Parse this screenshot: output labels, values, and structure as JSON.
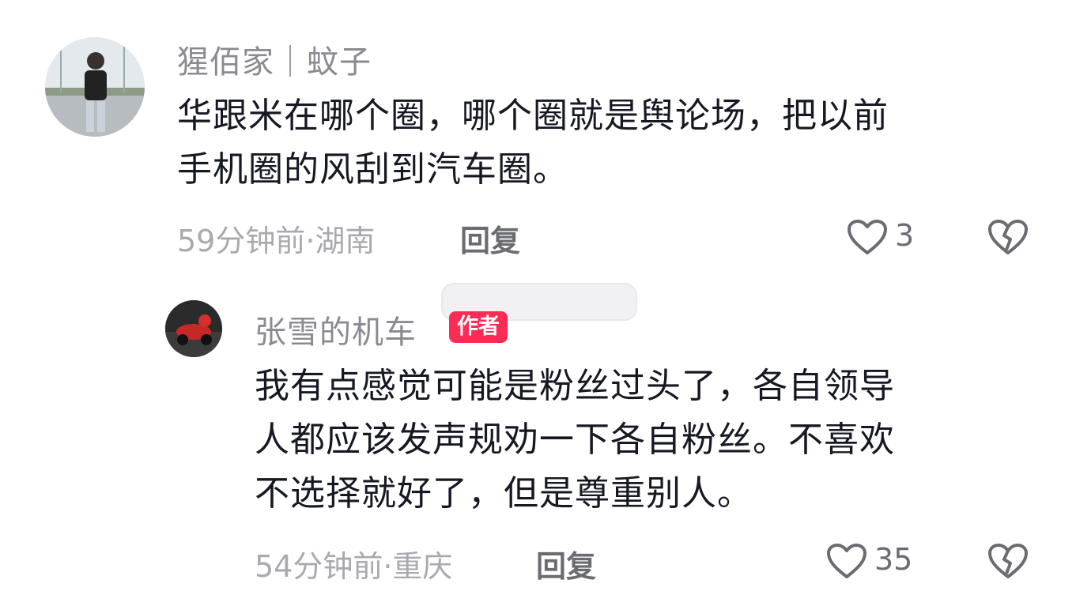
{
  "comment": {
    "username": "猩佰家｜蚊子",
    "text_lines": [
      "华跟米在哪个圈，哪个圈就是舆论场，把以前",
      "手机圈的风刮到汽车圈。"
    ],
    "time_location": "59分钟前·湖南",
    "reply_label": "回复",
    "like_count": "3"
  },
  "reply": {
    "username": "张雪的机车",
    "badge": "作者",
    "text_lines": [
      "我有点感觉可能是粉丝过头了，各自领导",
      "人都应该发声规劝一下各自粉丝。不喜欢",
      "不选择就好了，但是尊重别人。"
    ],
    "time_location": "54分钟前·重庆",
    "reply_label": "回复",
    "like_count": "35"
  },
  "icons": {
    "like": "heart-outline-icon",
    "dislike": "broken-heart-icon"
  },
  "colors": {
    "author_badge": "#fe2c55",
    "text": "#161823",
    "meta": "#a9aab0"
  }
}
